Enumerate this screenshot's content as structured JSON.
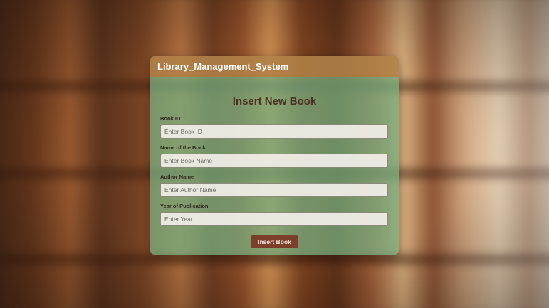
{
  "app": {
    "title": "Library_Management_System"
  },
  "form": {
    "heading": "Insert New Book",
    "fields": [
      {
        "label": "Book ID",
        "placeholder": "Enter Book ID",
        "value": ""
      },
      {
        "label": "Name of the Book",
        "placeholder": "Enter Book Name",
        "value": ""
      },
      {
        "label": "Author Name",
        "placeholder": "Enter Author Name",
        "value": ""
      },
      {
        "label": "Year of Publication",
        "placeholder": "Enter Year",
        "value": ""
      }
    ],
    "submit_label": "Insert Book"
  },
  "colors": {
    "header_bg": "#b08248",
    "body_bg": "#76b282",
    "button_bg": "#7b3f2c",
    "heading_text": "#4a3020"
  }
}
